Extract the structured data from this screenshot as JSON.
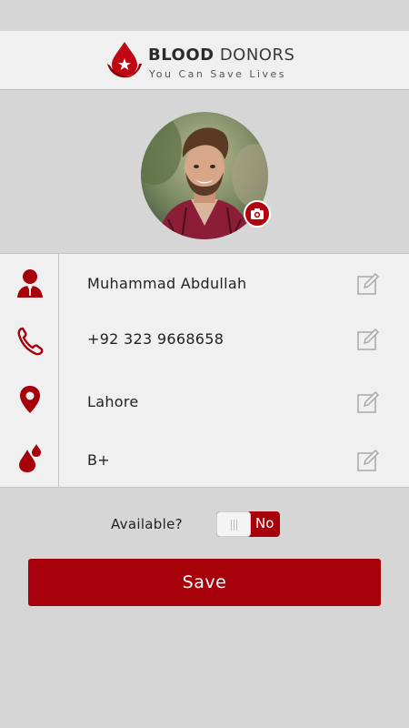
{
  "header": {
    "brand_bold": "BLOOD",
    "brand_rest": " DONORS",
    "tagline": "You Can Save Lives"
  },
  "profile": {
    "name": "Muhammad Abdullah",
    "phone": "+92 323 9668658",
    "city": "Lahore",
    "blood_group": "B+"
  },
  "availability": {
    "label": "Available?",
    "toggle_text": "No",
    "is_available": false
  },
  "actions": {
    "save_label": "Save"
  },
  "colors": {
    "accent": "#a6000a",
    "background": "#d6d6d6",
    "row_background": "#f0f0f0"
  },
  "icons": {
    "name": "user-icon",
    "phone": "phone-icon",
    "city": "location-pin-icon",
    "blood": "blood-drops-icon",
    "edit": "edit-pencil-icon",
    "camera": "camera-icon"
  }
}
